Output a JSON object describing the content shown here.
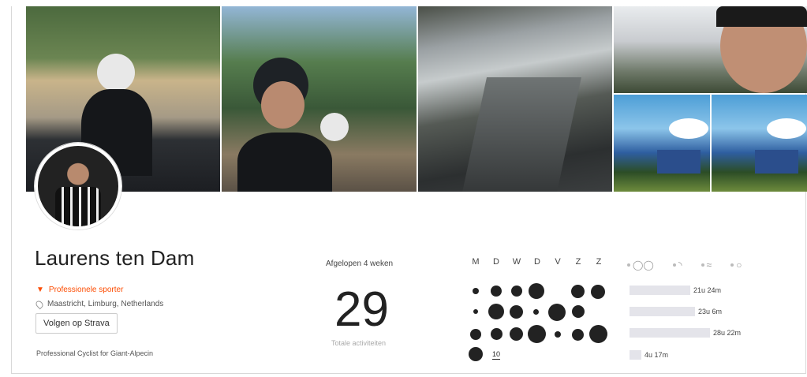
{
  "profile": {
    "name": "Laurens ten Dam",
    "role": "Professionele sporter",
    "location": "Maastricht, Limburg, Netherlands",
    "follow_label": "Volgen op Strava",
    "bio": "Professional Cyclist for Giant-Alpecin"
  },
  "stats": {
    "period_label": "Afgelopen 4 weken",
    "total_activities": "29",
    "total_label": "Totale activiteiten"
  },
  "weekdays": [
    "M",
    "D",
    "W",
    "D",
    "V",
    "Z",
    "Z"
  ],
  "activity_grid": {
    "current_week_count": "10"
  },
  "sport_tabs": [
    {
      "icon": "bike-icon"
    },
    {
      "icon": "shoe-icon"
    },
    {
      "icon": "swim-icon"
    },
    {
      "icon": "other-icon"
    }
  ],
  "weekly_time": [
    {
      "label": "21u 24m",
      "fraction": 0.45
    },
    {
      "label": "23u 6m",
      "fraction": 0.49
    },
    {
      "label": "28u 22m",
      "fraction": 0.6
    },
    {
      "label": "4u 17m",
      "fraction": 0.09
    }
  ],
  "colors": {
    "accent": "#fc4c02",
    "bar": "#e4e4ea",
    "dot": "#222222"
  }
}
